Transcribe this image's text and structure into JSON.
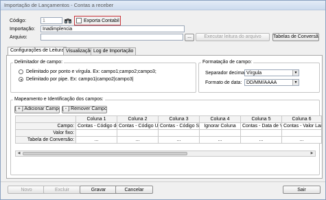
{
  "window": {
    "title": "Importação de Lançamentos - Contas a receber"
  },
  "form": {
    "codigo_label": "Código:",
    "codigo_value": "1",
    "exporta_label": "Exporta Contabil",
    "importacao_label": "Importação:",
    "importacao_value": "Inadimplencia",
    "arquivo_label": "Arquivo:",
    "arquivo_value": "",
    "browse_label": "...",
    "executar_label": "Executar leitura do arquivo",
    "tabelas_label": "Tabelas de Conversão"
  },
  "tabs": [
    {
      "label": "Configurações de Leitura",
      "active": true
    },
    {
      "label": "Visualização",
      "active": false
    },
    {
      "label": "Log de Importação",
      "active": false
    }
  ],
  "delimitador": {
    "title": "Delimitador de campo:",
    "option1": "Delimitado por ponto e vírgula. Ex: campo1;campo2;campo3;",
    "option2": "Delimitado por pipe. Ex: campo1|campo2|campo3|",
    "selected": 2
  },
  "formatacao": {
    "title": "Formatação de campo:",
    "separador_label": "Separador decimal:",
    "separador_value": "Vírgula",
    "formato_label": "Formato de data:",
    "formato_value": "DD/MM/AAAA"
  },
  "mapeamento": {
    "title": "Mapeamento e Identificação dos campos:",
    "add_label": "[ + ] Adicionar Campo",
    "remove_label": "[ - ] Remover Campo",
    "columns": [
      "Coluna 1",
      "Coluna 2",
      "Coluna 3",
      "Coluna 4",
      "Coluna 5",
      "Coluna 6"
    ],
    "row_labels": [
      "Campo:",
      "Valor fixo:",
      "Tabela de Conversão:"
    ],
    "campo_values": [
      "Contas - Código do",
      "Contas - Código Uni",
      "Contas - Código Sac",
      "Ignorar Coluna",
      "Contas - Data de Ve",
      "Contas - Valor Lanç"
    ],
    "conversao_values": [
      "...",
      "...",
      "...",
      "...",
      "...",
      "..."
    ]
  },
  "footer": {
    "novo": "Novo",
    "excluir": "Excluir",
    "gravar": "Gravar",
    "cancelar": "Cancelar",
    "sair": "Sair"
  }
}
